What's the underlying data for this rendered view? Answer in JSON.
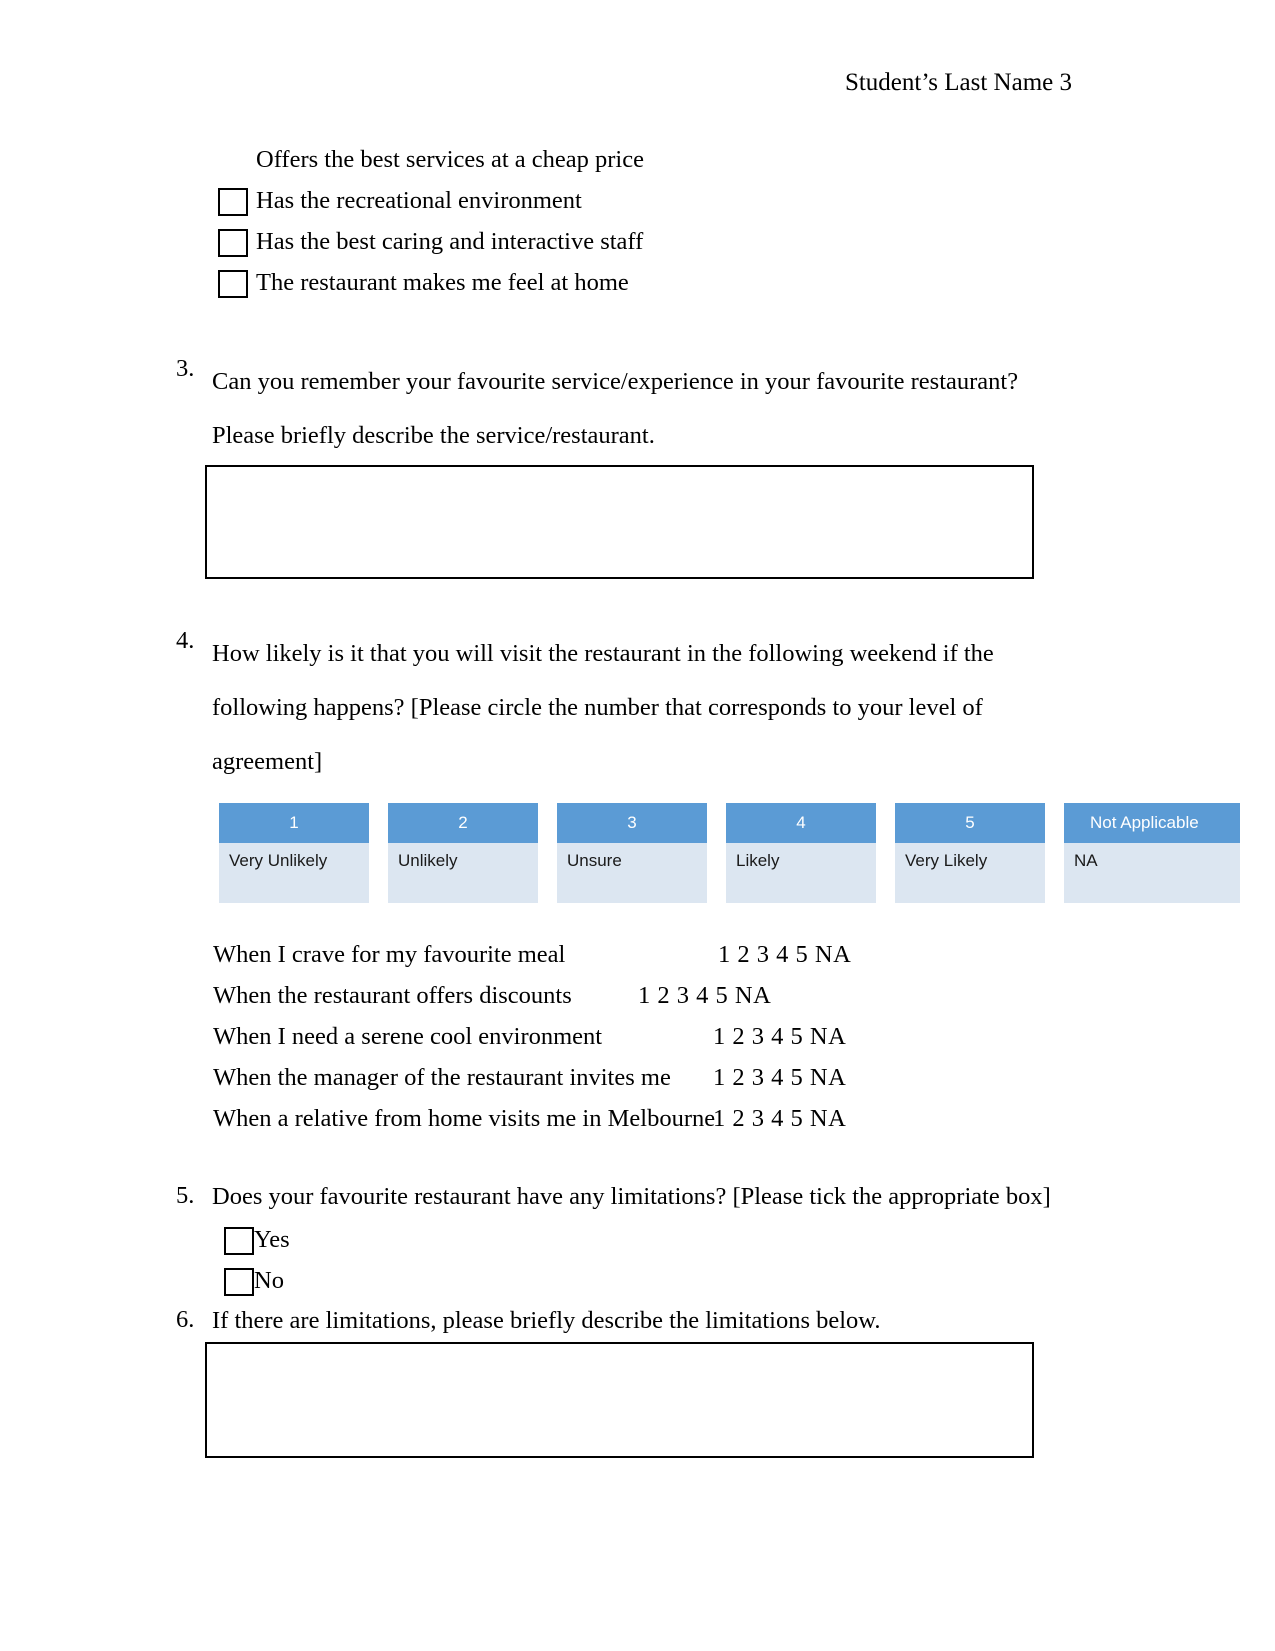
{
  "header": {
    "running_head": "Student’s Last Name 3"
  },
  "top_options": [
    {
      "label": "Offers the best services at a cheap price",
      "has_checkbox": false
    },
    {
      "label": "Has the recreational environment",
      "has_checkbox": true
    },
    {
      "label": "Has the best caring and interactive staff",
      "has_checkbox": true
    },
    {
      "label": "The restaurant makes me feel at home",
      "has_checkbox": true
    }
  ],
  "questions": {
    "q3": {
      "number": "3.",
      "text": "Can you remember your favourite service/experience in your favourite restaurant? Please briefly describe the service/restaurant."
    },
    "q4": {
      "number": "4.",
      "text": "How likely is it that you will visit the restaurant in the following weekend if the following happens? [Please circle the number that corresponds to your level of agreement]"
    },
    "q5": {
      "number": "5.",
      "text": "Does your favourite restaurant have any limitations? [Please tick the appropriate box]"
    },
    "q6": {
      "number": "6.",
      "text": "If there are limitations, please briefly describe the limitations below."
    }
  },
  "legend": {
    "header_color": "#5b9bd5",
    "body_color": "#dce6f1",
    "columns": [
      {
        "value": "1",
        "label": "Very Unlikely"
      },
      {
        "value": "2",
        "label": "Unlikely"
      },
      {
        "value": "3",
        "label": "Unsure"
      },
      {
        "value": "4",
        "label": "Likely"
      },
      {
        "value": "5",
        "label": "Very Likely"
      },
      {
        "value": "Not Applicable",
        "label": "NA"
      }
    ]
  },
  "likert_rows": [
    {
      "statement": "When I crave for my favourite meal",
      "scale": "1  2  3  4  5  NA"
    },
    {
      "statement": "When the restaurant offers discounts",
      "scale": "1  2  3   4  5  NA"
    },
    {
      "statement": "When I need a serene cool environment",
      "scale": "1  2  3   4  5  NA"
    },
    {
      "statement": "When the manager of the restaurant invites me",
      "scale": "1  2  3   4  5  NA"
    },
    {
      "statement": "When a relative from home visits me in Melbourne",
      "scale": "1  2  3   4  5  NA"
    }
  ],
  "yesno_options": [
    {
      "label": "Yes"
    },
    {
      "label": "No"
    }
  ]
}
